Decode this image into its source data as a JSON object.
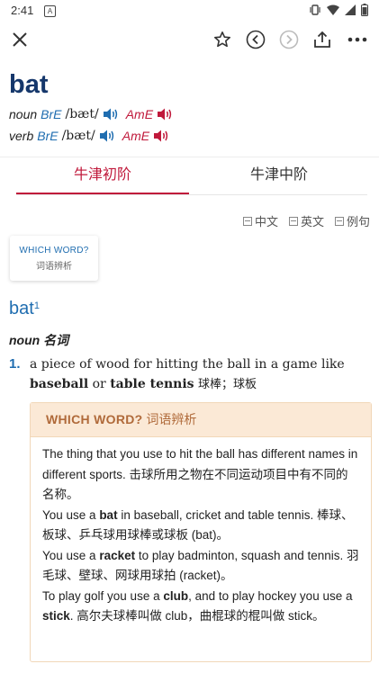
{
  "status": {
    "time": "2:41",
    "app_badge": "A"
  },
  "headword": "bat",
  "pronunciations": [
    {
      "pos": "noun",
      "bre_label": "BrE",
      "ipa": "/bæt/",
      "ame_label": "AmE"
    },
    {
      "pos": "verb",
      "bre_label": "BrE",
      "ipa": "/bæt/",
      "ame_label": "AmE"
    }
  ],
  "tabs": [
    {
      "label": "牛津初阶",
      "active": true
    },
    {
      "label": "牛津中阶",
      "active": false
    }
  ],
  "display_options": [
    "中文",
    "英文",
    "例句"
  ],
  "which_word_card": {
    "line1": "WHICH WORD?",
    "line2": "词语辨析"
  },
  "entry": {
    "word": "bat",
    "homograph": "1",
    "pos": "noun 名词",
    "sense": {
      "number": "1.",
      "def_start": "a piece of wood for hitting the ball in a game like",
      "kw1": "baseball",
      "mid": "or",
      "kw2": "table tennis",
      "zh": "球棒；球板"
    }
  },
  "which_word_box": {
    "title_en": "WHICH WORD?",
    "title_zh": "词语辨析",
    "p1": "The thing that you use to hit the ball has different names in different sports. 击球所用之物在不同运动项目中有不同的名称。",
    "p2_a": "You use a ",
    "p2_kw": "bat",
    "p2_b": " in baseball, cricket and table tennis. 棒球、板球、乒乓球用球棒或球板 (bat)。",
    "p3_a": "You use a ",
    "p3_kw": "racket",
    "p3_b": " to play badminton, squash and tennis. 羽毛球、壁球、网球用球拍 (racket)。",
    "p4_a": "To play golf you use a ",
    "p4_kw1": "club",
    "p4_b": ", and to play hockey you use a ",
    "p4_kw2": "stick",
    "p4_c": ". 高尔夫球棒叫做 club，曲棍球的棍叫做 stick。"
  },
  "colors": {
    "primary_blue": "#15376b",
    "link_blue": "#1f6db0",
    "accent_red": "#c0193b",
    "which_word_bg": "#fbe9d6"
  },
  "icons": [
    "close-icon",
    "star-icon",
    "back-circle-icon",
    "forward-circle-icon",
    "share-icon",
    "more-icon",
    "speaker-icon"
  ]
}
